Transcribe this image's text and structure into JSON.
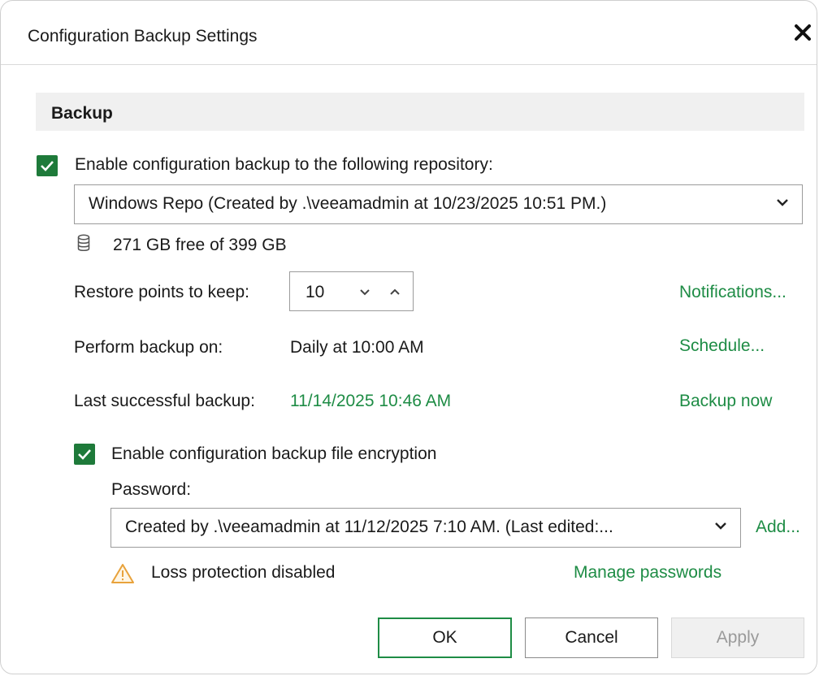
{
  "window": {
    "title": "Configuration Backup Settings"
  },
  "section": {
    "title": "Backup"
  },
  "backup": {
    "enable_label": "Enable configuration backup to the following repository:",
    "enable_checked": true,
    "repository": "Windows Repo (Created by .\\veeamadmin at 10/23/2025 10:51 PM.)",
    "free_space": "271 GB free of 399 GB",
    "restore_points_label": "Restore points to keep:",
    "restore_points_value": "10",
    "notifications_link": "Notifications...",
    "perform_label": "Perform backup on:",
    "perform_value": "Daily at 10:00 AM",
    "schedule_link": "Schedule...",
    "last_label": "Last successful backup:",
    "last_value": "11/14/2025 10:46 AM",
    "backup_now_link": "Backup now"
  },
  "encryption": {
    "enable_label": "Enable configuration backup file encryption",
    "enable_checked": true,
    "password_label": "Password:",
    "password_value": "Created by .\\veeamadmin at 11/12/2025 7:10 AM. (Last edited:...",
    "add_link": "Add...",
    "warning_text": "Loss protection disabled",
    "manage_link": "Manage passwords"
  },
  "buttons": {
    "ok": "OK",
    "cancel": "Cancel",
    "apply": "Apply"
  },
  "colors": {
    "accent": "#1e8c45",
    "checkbox": "#1e7a3a",
    "warning": "#e8a23b"
  }
}
